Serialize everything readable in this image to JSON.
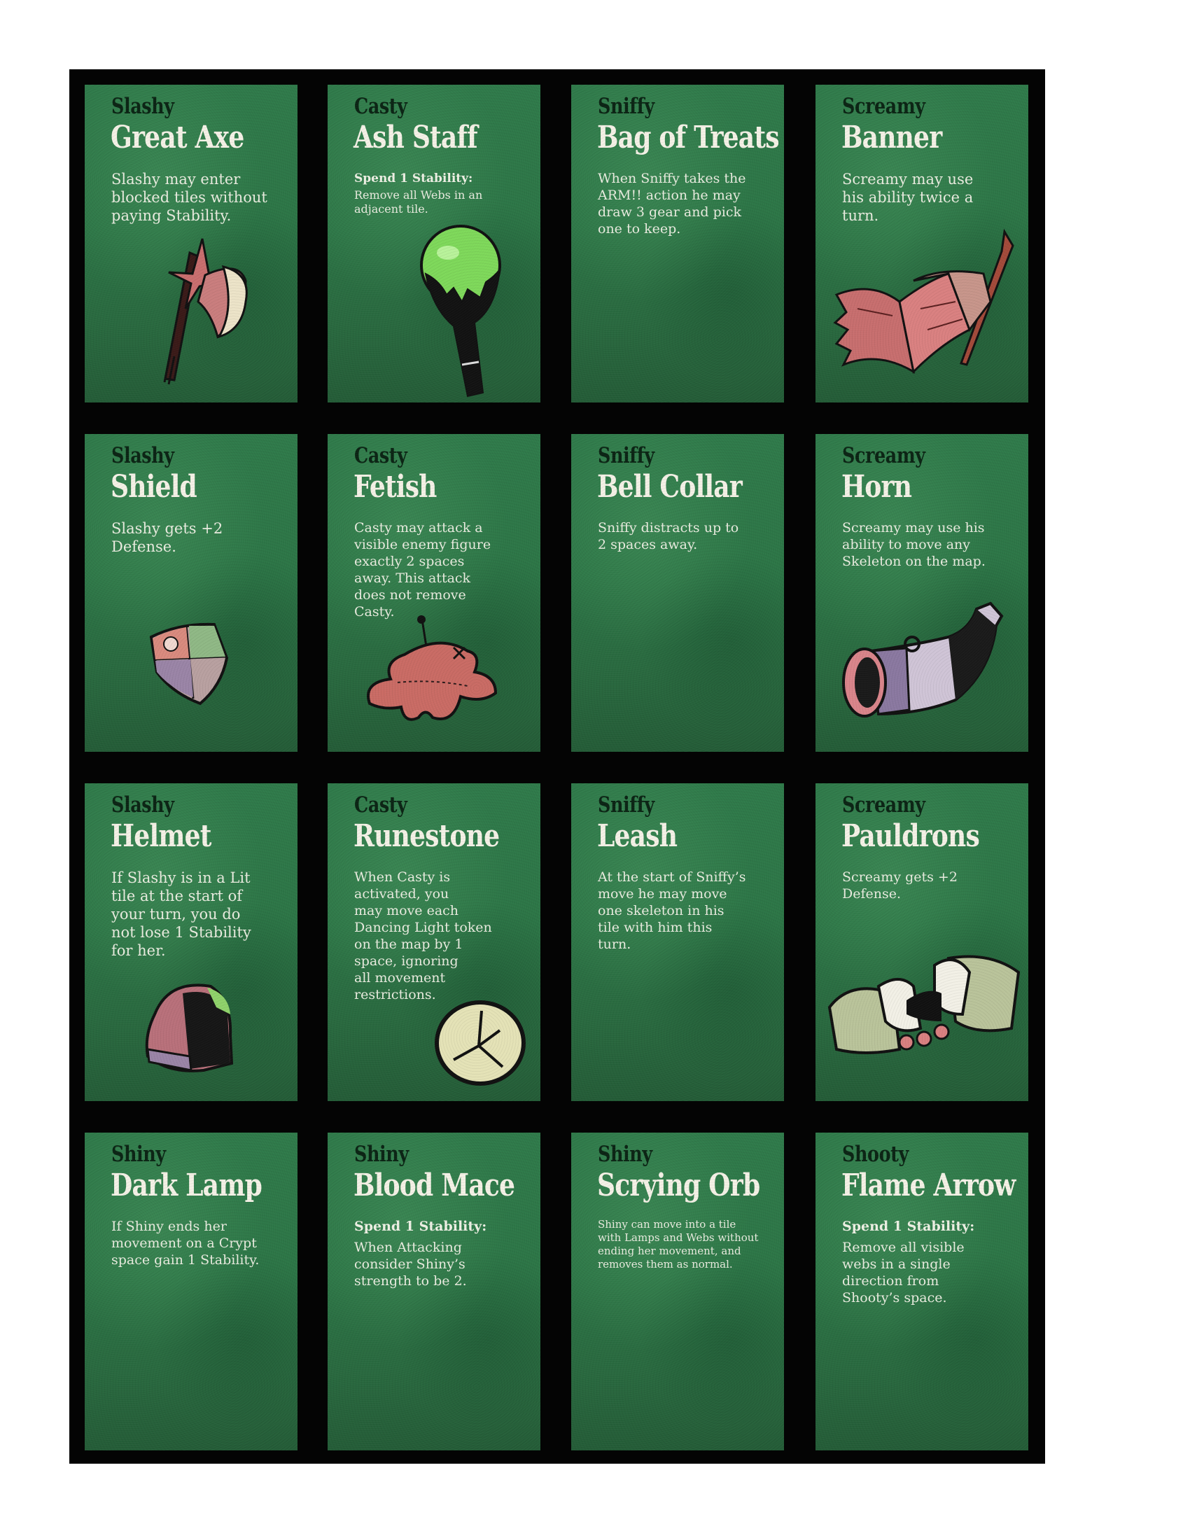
{
  "cards": [
    {
      "owner": "Slashy",
      "title": "Great Axe",
      "description": "Slashy may enter\nblocked tiles without\npaying Stability.",
      "spend": "",
      "icon": "great-axe-icon"
    },
    {
      "owner": "Casty",
      "title": "Ash Staff",
      "description": "Remove all Webs in an\nadjacent tile.",
      "spend": "Spend 1 Stability:",
      "icon": "ash-staff-icon"
    },
    {
      "owner": "Sniffy",
      "title": "Bag of Treats",
      "description": "When Sniffy takes the\nARM!! action he may\ndraw 3 gear and pick\none to keep.",
      "spend": "",
      "icon": ""
    },
    {
      "owner": "Screamy",
      "title": "Banner",
      "description": "Screamy may use\nhis ability twice a\nturn.",
      "spend": "",
      "icon": "banner-icon"
    },
    {
      "owner": "Slashy",
      "title": "Shield",
      "description": "Slashy gets +2\nDefense.",
      "spend": "",
      "icon": "shield-icon"
    },
    {
      "owner": "Casty",
      "title": "Fetish",
      "description": "Casty may attack a\nvisible enemy figure\nexactly 2 spaces\naway. This attack\ndoes not remove\nCasty.",
      "spend": "",
      "icon": "fetish-doll-icon"
    },
    {
      "owner": "Sniffy",
      "title": "Bell Collar",
      "description": "Sniffy distracts up to\n2 spaces away.",
      "spend": "",
      "icon": ""
    },
    {
      "owner": "Screamy",
      "title": "Horn",
      "description": "Screamy may use his\nability to move any\nSkeleton on the map.",
      "spend": "",
      "icon": "horn-icon"
    },
    {
      "owner": "Slashy",
      "title": "Helmet",
      "description": "If Slashy is in a Lit\ntile at the start of\nyour turn, you do\nnot lose 1 Stability\nfor her.",
      "spend": "",
      "icon": "helmet-icon"
    },
    {
      "owner": "Casty",
      "title": "Runestone",
      "description": "When Casty is\nactivated, you\nmay move each\nDancing Light token\non the map by 1\nspace, ignoring\nall movement\nrestrictions.",
      "spend": "",
      "icon": "runestone-icon"
    },
    {
      "owner": "Sniffy",
      "title": "Leash",
      "description": "At the start of Sniffy’s\nmove he may move\none skeleton in his\ntile with him this\nturn.",
      "spend": "",
      "icon": ""
    },
    {
      "owner": "Screamy",
      "title": "Pauldrons",
      "description": "Screamy gets +2\nDefense.",
      "spend": "",
      "icon": "pauldrons-icon"
    },
    {
      "owner": "Shiny",
      "title": "Dark Lamp",
      "description": "If Shiny ends her\nmovement on a Crypt\nspace gain 1 Stability.",
      "spend": "",
      "icon": ""
    },
    {
      "owner": "Shiny",
      "title": "Blood Mace",
      "description": "When Attacking\nconsider Shiny’s\nstrength to be 2.",
      "spend": "Spend 1 Stability:",
      "icon": ""
    },
    {
      "owner": "Shiny",
      "title": "Scrying Orb",
      "description": "Shiny can move into a tile\nwith Lamps and Webs without\nending her movement, and\nremoves them as normal.",
      "spend": "",
      "icon": ""
    },
    {
      "owner": "Shooty",
      "title": "Flame Arrow",
      "description": "Remove all visible\nwebs in a single\ndirection from\nShooty’s space.",
      "spend": "Spend 1 Stability:",
      "icon": ""
    }
  ],
  "colors": {
    "card_green": "#2c7546",
    "owner_text": "#0b2414",
    "title_text": "#f4f1e6",
    "sheet_black": "#040404"
  }
}
